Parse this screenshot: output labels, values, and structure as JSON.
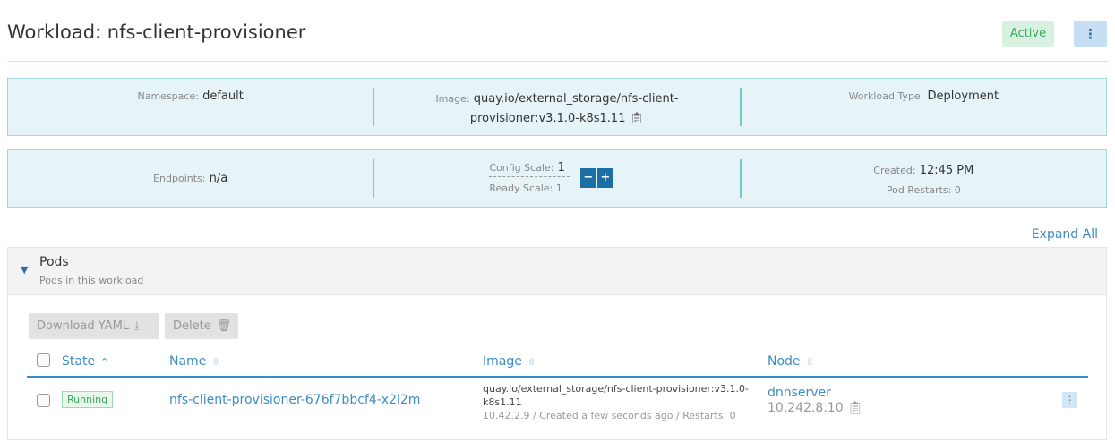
{
  "header": {
    "title": "Workload: nfs-client-provisioner",
    "status": "Active"
  },
  "info1": {
    "namespace_label": "Namespace:",
    "namespace": "default",
    "image_label": "Image:",
    "image_line1": "quay.io/external_storage/nfs-client-",
    "image_line2": "provisioner:v3.1.0-k8s1.11",
    "type_label": "Workload Type:",
    "type": "Deployment"
  },
  "info2": {
    "endpoints_label": "Endpoints:",
    "endpoints": "n/a",
    "config_scale_label": "Config Scale:",
    "config_scale": "1",
    "ready_scale": "Ready Scale: 1",
    "minus": "−",
    "plus": "+",
    "created_label": "Created:",
    "created": "12:45 PM",
    "restarts": "Pod Restarts: 0"
  },
  "expand_all": "Expand All",
  "pods": {
    "title": "Pods",
    "subtitle": "Pods in this workload",
    "download": "Download YAML",
    "delete": "Delete",
    "columns": [
      "State",
      "Name",
      "Image",
      "Node"
    ],
    "rows": [
      {
        "state": "Running",
        "name": "nfs-client-provisioner-676f7bbcf4-x2l2m",
        "image_line1": "quay.io/external_storage/nfs-client-provisioner:v3.1.0-",
        "image_line2": "k8s1.11",
        "meta": "10.42.2.9 / Created a few seconds ago / Restarts: 0",
        "node": "dnnserver",
        "node_ip": "10.242.8.10"
      }
    ]
  }
}
